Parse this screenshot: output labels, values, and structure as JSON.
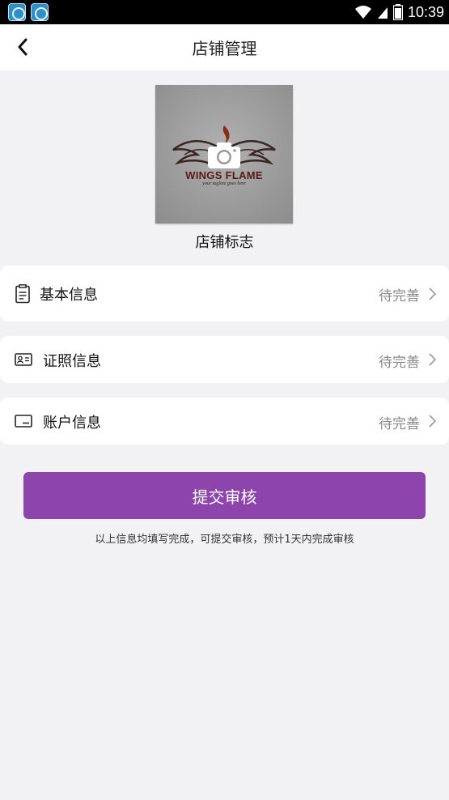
{
  "status_bar": {
    "time": "10:39",
    "app_icons": [
      "app-icon",
      "app-icon"
    ]
  },
  "header": {
    "title": "店铺管理",
    "back_icon": "chevron-left-icon"
  },
  "logo": {
    "brand_text": "WINGS FLAME",
    "tagline": "your tagline goes here",
    "label": "店铺标志",
    "camera_icon": "camera-icon"
  },
  "sections": [
    {
      "label": "基本信息",
      "status": "待完善",
      "icon": "document-icon"
    },
    {
      "label": "证照信息",
      "status": "待完善",
      "icon": "id-card-icon"
    },
    {
      "label": "账户信息",
      "status": "待完善",
      "icon": "card-icon"
    }
  ],
  "submit": {
    "label": "提交审核",
    "hint": "以上信息均填写完成，可提交审核，预计1天内完成审核"
  },
  "colors": {
    "accent": "#8e44ad",
    "background": "#f2f2f4",
    "status_text": "#888888"
  }
}
